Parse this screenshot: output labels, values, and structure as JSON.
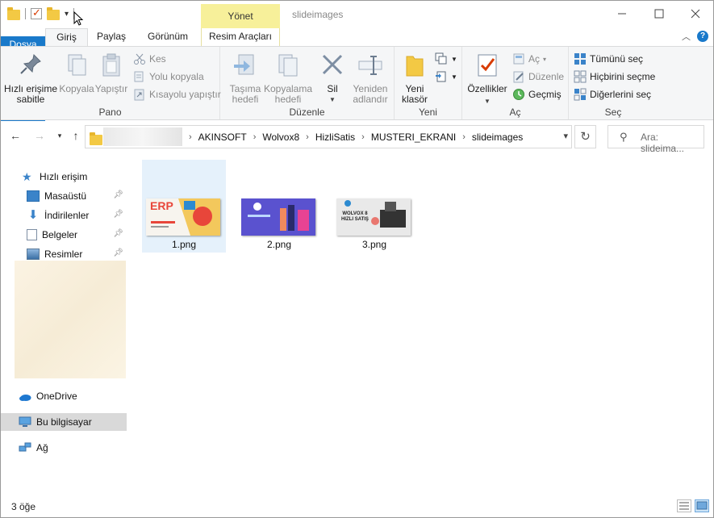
{
  "title_bar": {
    "context_tab_header": "Yönet",
    "window_title": "slideimages"
  },
  "ribbon_tabs": {
    "file": "Dosya",
    "home": "Giriş",
    "share": "Paylaş",
    "view": "Görünüm",
    "picture_tools": "Resim Araçları"
  },
  "ribbon": {
    "clipboard": {
      "group": "Pano",
      "pin": "Hızlı erişime sabitle",
      "copy": "Kopyala",
      "paste": "Yapıştır",
      "cut": "Kes",
      "copy_path": "Yolu kopyala",
      "paste_shortcut": "Kısayolu yapıştır"
    },
    "organize": {
      "group": "Düzenle",
      "move_to": "Taşıma hedefi",
      "copy_to": "Kopyalama hedefi",
      "delete": "Sil",
      "rename": "Yeniden adlandır"
    },
    "new": {
      "group": "Yeni",
      "new_folder": "Yeni klasör"
    },
    "open": {
      "group": "Aç",
      "properties": "Özellikler",
      "open": "Aç",
      "edit": "Düzenle",
      "history": "Geçmiş"
    },
    "select": {
      "group": "Seç",
      "select_all": "Tümünü seç",
      "select_none": "Hiçbirini seçme",
      "invert": "Diğerlerini seç"
    }
  },
  "address": {
    "crumbs": [
      "AKINSOFT",
      "Wolvox8",
      "HizliSatis",
      "MUSTERI_EKRANI",
      "slideimages"
    ],
    "search_placeholder": "Ara: slideima..."
  },
  "nav_pane": {
    "quick_access": "Hızlı erişim",
    "desktop": "Masaüstü",
    "downloads": "İndirilenler",
    "documents": "Belgeler",
    "pictures": "Resimler",
    "onedrive": "OneDrive",
    "this_pc": "Bu bilgisayar",
    "network": "Ağ"
  },
  "files": [
    {
      "name": "1.png",
      "thumb_text": "ERP"
    },
    {
      "name": "2.png",
      "thumb_text": ""
    },
    {
      "name": "3.png",
      "thumb_text": "WOLVOX 8 HIZLI SATIŞ"
    }
  ],
  "status": {
    "count": "3 öğe"
  },
  "colors": {
    "file_tab": "#1979ca",
    "context_tab": "#f7f09a",
    "selection": "#e5f1fb"
  }
}
